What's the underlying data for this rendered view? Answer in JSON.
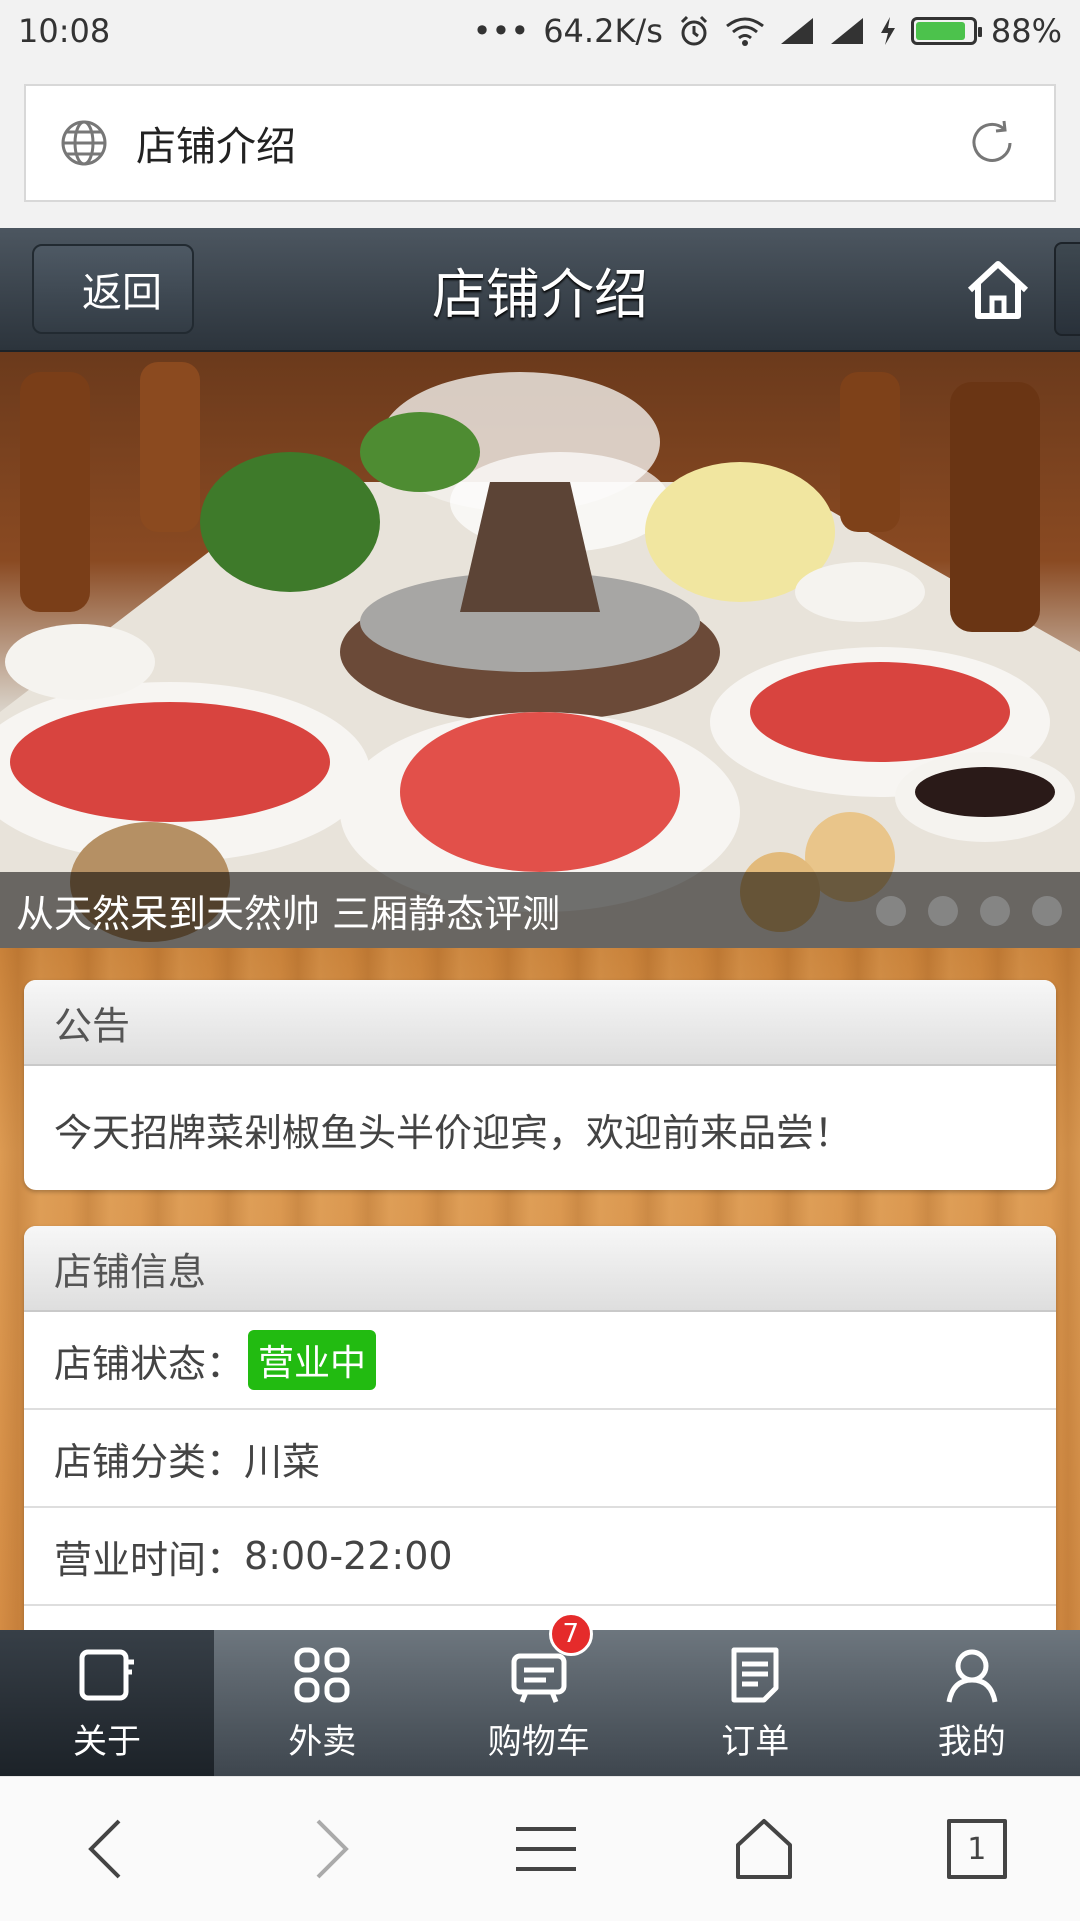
{
  "status_bar": {
    "time": "10:08",
    "dots": "•••",
    "net_speed": "64.2K/s",
    "battery_percent": "88%",
    "battery_level": 0.88
  },
  "browser": {
    "address_text": "店铺介绍"
  },
  "header": {
    "back_label": "返回",
    "title": "店铺介绍"
  },
  "banner": {
    "caption": "从天然呆到天然帅 三厢静态评测",
    "slide_count": 4
  },
  "notice": {
    "heading": "公告",
    "text": "今天招牌菜剁椒鱼头半价迎宾，欢迎前来品尝！"
  },
  "shop_info": {
    "heading": "店铺信息",
    "status_label": "店铺状态：",
    "status_value": "营业中",
    "category_label": "店铺分类：",
    "category_value": "川菜",
    "hours_label": "营业时间：",
    "hours_value": "8:00-22:00"
  },
  "tabs": [
    {
      "label": "关于",
      "icon": "about-icon"
    },
    {
      "label": "外卖",
      "icon": "grid-icon"
    },
    {
      "label": "购物车",
      "icon": "cart-icon",
      "badge": "7"
    },
    {
      "label": "订单",
      "icon": "order-icon"
    },
    {
      "label": "我的",
      "icon": "user-icon"
    }
  ],
  "nav": {
    "tab_count": "1"
  },
  "colors": {
    "header_dark": "#2c343c",
    "status_green": "#22bb11",
    "badge_red": "#e52b2b"
  }
}
